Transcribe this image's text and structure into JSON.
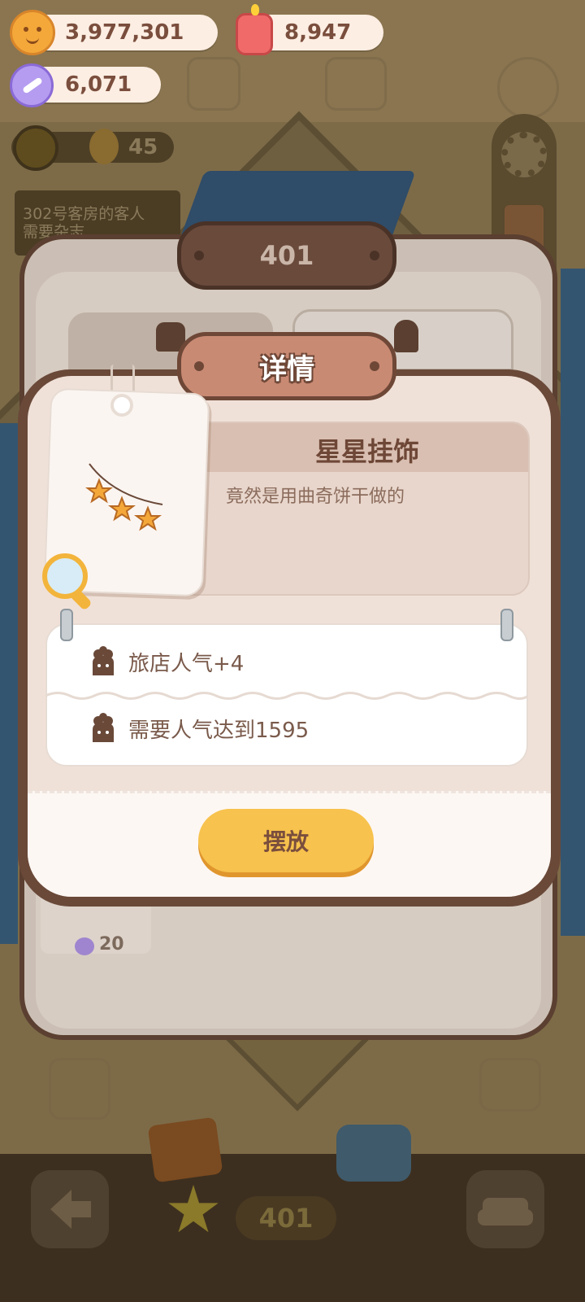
{
  "currencies": {
    "cookies": "3,977,301",
    "candle": "8,947",
    "gems": "6,071"
  },
  "status": {
    "visitors": "45",
    "quest_line1": "302号客房的客人",
    "quest_line2": "需要杂志"
  },
  "room": {
    "number": "401",
    "card_price": "20"
  },
  "dialog": {
    "title": "详情",
    "item_name": "星星挂饰",
    "item_description": "竟然是用曲奇饼干做的",
    "stat_popularity_bonus": "旅店人气+4",
    "stat_requirement": "需要人气达到1595",
    "place_button": "摆放"
  },
  "bottom_bar": {
    "room_number": "401"
  },
  "colors": {
    "accent": "#f7c24d",
    "title_brown": "#6e4737",
    "text_brown": "#7a4e3d",
    "panel": "#f0e1d8"
  },
  "icons": {
    "cookie": "cookie-coin-icon",
    "candle": "candle-icon",
    "gem": "candy-gem-icon",
    "popularity": "cake-popularity-icon",
    "magnifier": "magnifier-icon",
    "back": "back-arrow-icon",
    "furniture": "sofa-icon",
    "settings": "gear-icon"
  }
}
